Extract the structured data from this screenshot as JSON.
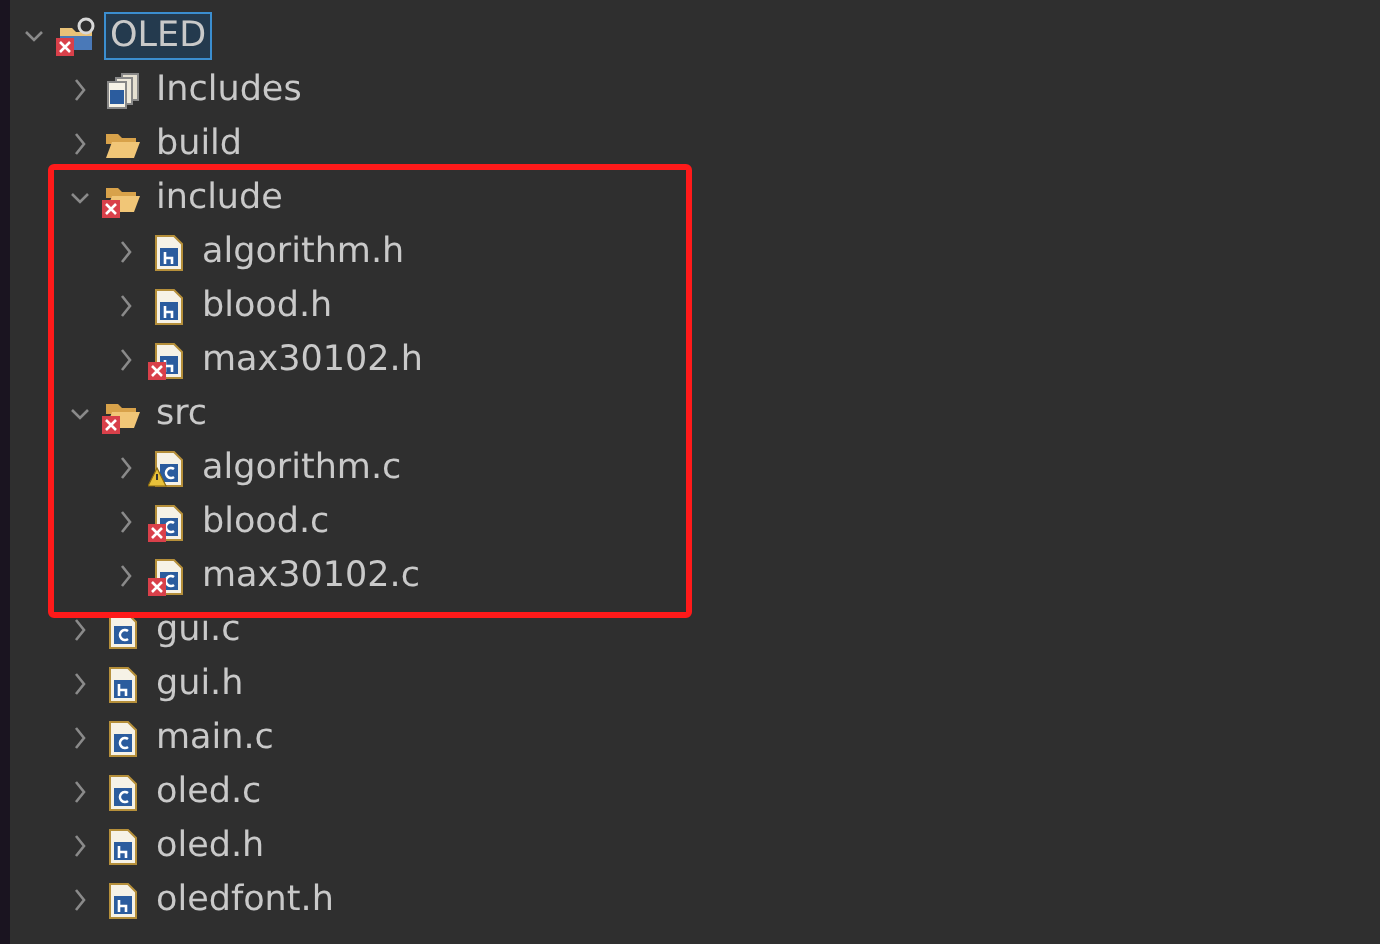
{
  "tree": [
    {
      "label": "OLED",
      "kind": "project",
      "expanded": true,
      "selected": true,
      "error": true,
      "warning": false,
      "highlighted": false,
      "children": [
        {
          "label": "Includes",
          "kind": "includes",
          "expanded": false,
          "selected": false,
          "error": false,
          "warning": false,
          "highlighted": false
        },
        {
          "label": "build",
          "kind": "folder",
          "expanded": false,
          "selected": false,
          "error": false,
          "warning": false,
          "highlighted": false
        },
        {
          "label": "include",
          "kind": "folder",
          "expanded": true,
          "selected": false,
          "error": true,
          "warning": false,
          "highlighted": true,
          "children": [
            {
              "label": "algorithm.h",
              "kind": "header",
              "expanded": false,
              "selected": false,
              "error": false,
              "warning": false,
              "highlighted": false
            },
            {
              "label": "blood.h",
              "kind": "header",
              "expanded": false,
              "selected": false,
              "error": false,
              "warning": false,
              "highlighted": false
            },
            {
              "label": "max30102.h",
              "kind": "header",
              "expanded": false,
              "selected": false,
              "error": true,
              "warning": false,
              "highlighted": false
            }
          ]
        },
        {
          "label": "src",
          "kind": "folder",
          "expanded": true,
          "selected": false,
          "error": true,
          "warning": false,
          "highlighted": true,
          "children": [
            {
              "label": "algorithm.c",
              "kind": "source",
              "expanded": false,
              "selected": false,
              "error": false,
              "warning": true,
              "highlighted": false
            },
            {
              "label": "blood.c",
              "kind": "source",
              "expanded": false,
              "selected": false,
              "error": true,
              "warning": false,
              "highlighted": false
            },
            {
              "label": "max30102.c",
              "kind": "source",
              "expanded": false,
              "selected": false,
              "error": true,
              "warning": false,
              "highlighted": false
            }
          ]
        },
        {
          "label": "gui.c",
          "kind": "source",
          "expanded": false,
          "selected": false,
          "error": false,
          "warning": false,
          "highlighted": false
        },
        {
          "label": "gui.h",
          "kind": "header",
          "expanded": false,
          "selected": false,
          "error": false,
          "warning": false,
          "highlighted": false
        },
        {
          "label": "main.c",
          "kind": "source",
          "expanded": false,
          "selected": false,
          "error": false,
          "warning": false,
          "highlighted": false
        },
        {
          "label": "oled.c",
          "kind": "source",
          "expanded": false,
          "selected": false,
          "error": false,
          "warning": false,
          "highlighted": false
        },
        {
          "label": "oled.h",
          "kind": "header",
          "expanded": false,
          "selected": false,
          "error": false,
          "warning": false,
          "highlighted": false
        },
        {
          "label": "oledfont.h",
          "kind": "header",
          "expanded": false,
          "selected": false,
          "error": false,
          "warning": false,
          "highlighted": false
        }
      ]
    }
  ],
  "annotation": {
    "color": "#ff1a1a"
  }
}
